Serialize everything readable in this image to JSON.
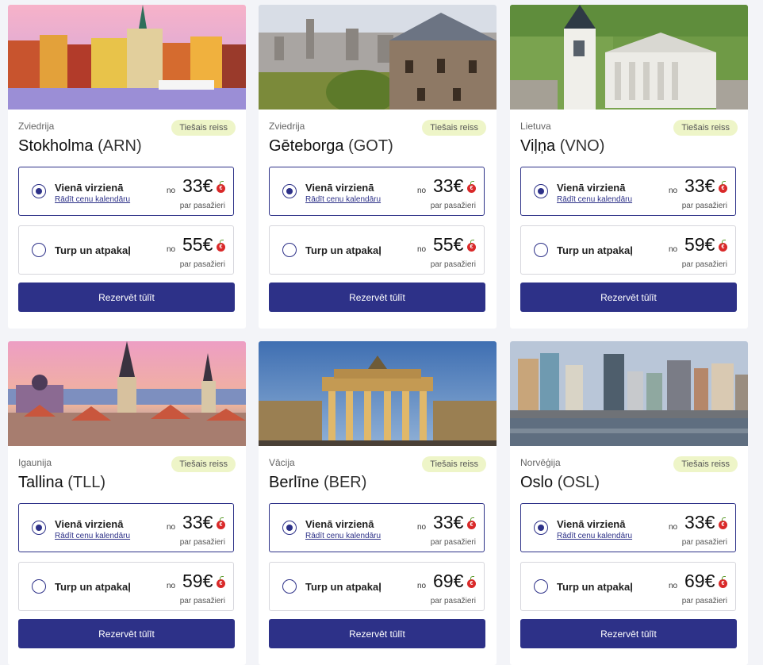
{
  "badge_label": "Tiešais reiss",
  "one_way_label": "Vienā virzienā",
  "round_trip_label": "Turp un atpakaļ",
  "calendar_link": "Rādīt cenu kalendāru",
  "from_label": "no",
  "per_passenger": "par pasažieri",
  "book_label": "Rezervēt tūlīt",
  "colors": {
    "primary": "#2d3188",
    "badge_bg": "#eef5c8",
    "euro_icon": "#d92929"
  },
  "icons": {
    "currency": "euro-cherry-icon"
  },
  "cards": [
    {
      "country": "Zviedrija",
      "city": "Stokholma",
      "code": "(ARN)",
      "one_way_price": "33€",
      "round_trip_price": "55€"
    },
    {
      "country": "Zviedrija",
      "city": "Gēteborga",
      "code": "(GOT)",
      "one_way_price": "33€",
      "round_trip_price": "55€"
    },
    {
      "country": "Lietuva",
      "city": "Viļņa",
      "code": "(VNO)",
      "one_way_price": "33€",
      "round_trip_price": "59€"
    },
    {
      "country": "Igaunija",
      "city": "Tallina",
      "code": "(TLL)",
      "one_way_price": "33€",
      "round_trip_price": "59€"
    },
    {
      "country": "Vācija",
      "city": "Berlīne",
      "code": "(BER)",
      "one_way_price": "33€",
      "round_trip_price": "69€"
    },
    {
      "country": "Norvēģija",
      "city": "Oslo",
      "code": "(OSL)",
      "one_way_price": "33€",
      "round_trip_price": "69€"
    }
  ]
}
